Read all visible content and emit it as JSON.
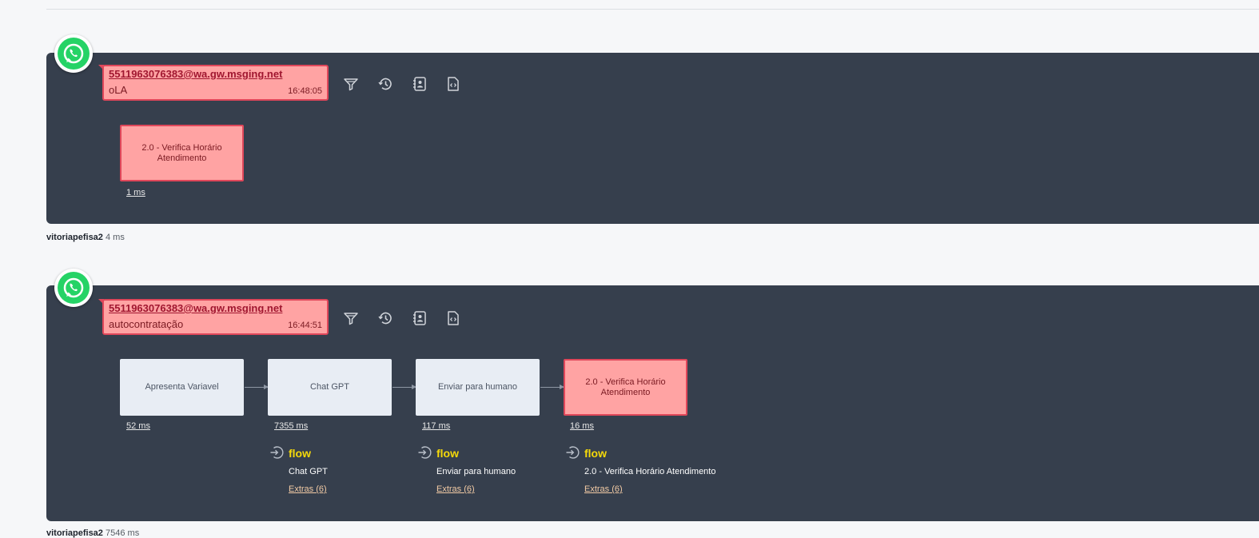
{
  "accent_colors": {
    "panel": "#363f4d",
    "error_fill": "#ffa3a3",
    "error_border": "#e0475a",
    "flow_title": "#f5d90a"
  },
  "entries": [
    {
      "channel_icon": "whatsapp-icon",
      "message": {
        "user": "5511963076383@wa.gw.msging.net",
        "text": "oLA",
        "time": "16:48:05"
      },
      "tools": [
        "filter-icon",
        "history-icon",
        "contact-icon",
        "code-file-icon"
      ],
      "nodes": [
        {
          "label": "2.0 - Verifica Horário Atendimento",
          "duration": "1 ms",
          "state": "error"
        }
      ],
      "footer": {
        "user": "vitoriapefisa2",
        "duration": "4 ms"
      }
    },
    {
      "channel_icon": "whatsapp-icon",
      "message": {
        "user": "5511963076383@wa.gw.msging.net",
        "text": "autocontratação",
        "time": "16:44:51"
      },
      "tools": [
        "filter-icon",
        "history-icon",
        "contact-icon",
        "code-file-icon"
      ],
      "nodes": [
        {
          "label": "Apresenta Variavel",
          "duration": "52 ms",
          "state": "ok"
        },
        {
          "label": "Chat GPT",
          "duration": "7355 ms",
          "state": "ok"
        },
        {
          "label": "Enviar para humano",
          "duration": "117 ms",
          "state": "ok"
        },
        {
          "label": "2.0 - Verifica Horário Atendimento",
          "duration": "16 ms",
          "state": "error"
        }
      ],
      "actions": [
        {
          "title": "flow",
          "value": "Chat GPT",
          "extras": "Extras (6)"
        },
        {
          "title": "flow",
          "value": "Enviar para humano",
          "extras": "Extras (6)"
        },
        {
          "title": "flow",
          "value": "2.0 - Verifica Horário Atendimento",
          "extras": "Extras (6)"
        }
      ],
      "footer": {
        "user": "vitoriapefisa2",
        "duration": "7546 ms"
      }
    }
  ]
}
